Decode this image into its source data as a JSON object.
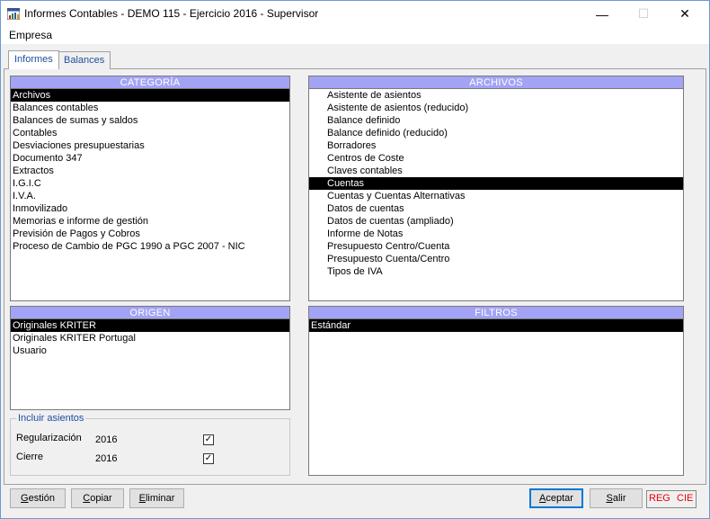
{
  "window": {
    "title": "Informes Contables - DEMO 115 - Ejercicio 2016 - Supervisor",
    "minimize": "—",
    "maximize": "☐",
    "close": "✕"
  },
  "menu": {
    "empresa": "Empresa"
  },
  "tabs": [
    {
      "label": "Informes",
      "active": true
    },
    {
      "label": "Balances",
      "active": false
    }
  ],
  "categoria": {
    "header": "CATEGORÍA",
    "items": [
      "Archivos",
      "Balances contables",
      "Balances de sumas y saldos",
      "Contables",
      "Desviaciones presupuestarias",
      "Documento 347",
      "Extractos",
      "I.G.I.C",
      "I.V.A.",
      "Inmovilizado",
      "Memorias e informe de gestión",
      "Previsión de Pagos y Cobros",
      "Proceso de Cambio de PGC 1990 a PGC 2007 - NIC"
    ],
    "selected_index": 0
  },
  "archivos": {
    "header": "ARCHIVOS",
    "items": [
      "Asistente de asientos",
      "Asistente de asientos (reducido)",
      "Balance definido",
      "Balance definido (reducido)",
      "Borradores",
      "Centros de Coste",
      "Claves contables",
      "Cuentas",
      "Cuentas y Cuentas Alternativas",
      "Datos de cuentas",
      "Datos de cuentas (ampliado)",
      "Informe de Notas",
      "Presupuesto Centro/Cuenta",
      "Presupuesto Cuenta/Centro",
      "Tipos de IVA"
    ],
    "selected_index": 7
  },
  "origen": {
    "header": "ORIGEN",
    "items": [
      "Originales KRITER",
      "Originales KRITER Portugal",
      "Usuario"
    ],
    "selected_index": 0
  },
  "filtros": {
    "header": "FILTROS",
    "items": [
      "Estándar"
    ],
    "selected_index": 0
  },
  "incluir_asientos": {
    "title": "Incluir asientos",
    "rows": [
      {
        "label": "Regularización",
        "year": "2016",
        "checked": true
      },
      {
        "label": "Cierre",
        "year": "2016",
        "checked": true
      }
    ],
    "check_mark": "✓"
  },
  "buttons": {
    "gestion": {
      "mnemonic": "G",
      "rest": "estión"
    },
    "copiar": {
      "mnemonic": "C",
      "rest": "opiar"
    },
    "eliminar": {
      "mnemonic": "E",
      "rest": "liminar"
    },
    "aceptar": {
      "mnemonic": "A",
      "rest": "ceptar"
    },
    "salir": {
      "mnemonic": "S",
      "rest": "alir"
    }
  },
  "status": {
    "reg": "REG",
    "cie": "CIE"
  },
  "colors": {
    "list_header": "#a3a3f5",
    "tab_text": "#1e4e9e",
    "status_red": "#e8000b"
  }
}
